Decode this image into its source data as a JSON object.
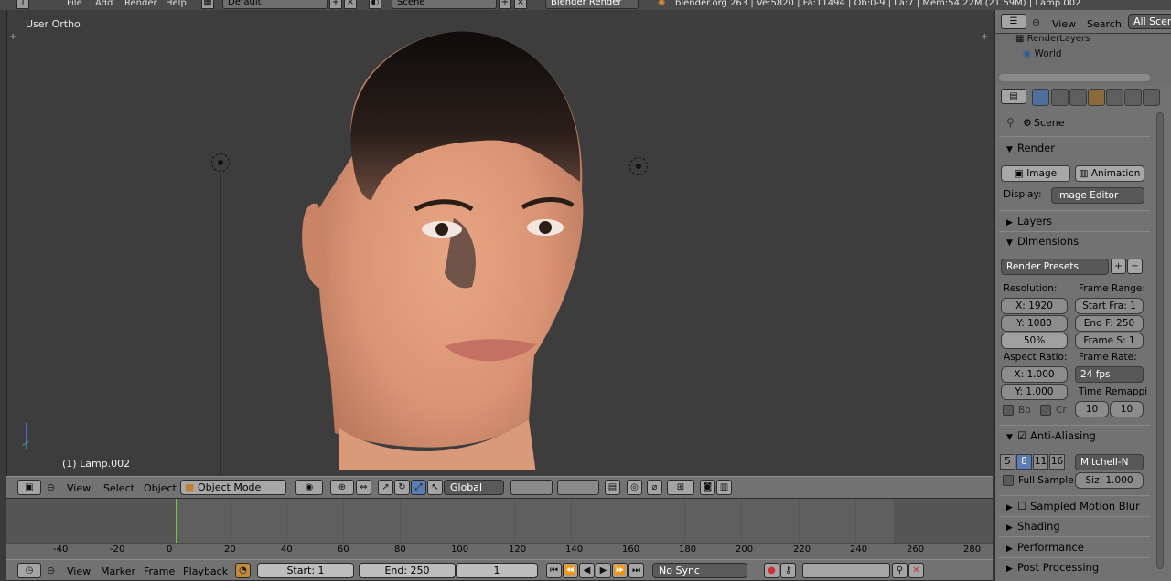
{
  "topbar": {
    "menus": [
      "File",
      "Add",
      "Render",
      "Help"
    ],
    "layout": "Default",
    "scene": "Scene",
    "engine": "Blender Render",
    "info": "blender.org 263 | Ve:5820 | Fa:11494 | Ob:0-9 | La:7 | Mem:54.22M (21.59M) | Lamp.002"
  },
  "viewport": {
    "title": "User Ortho",
    "object_label": "(1) Lamp.002"
  },
  "view3d_header": {
    "menus": [
      "View",
      "Select",
      "Object"
    ],
    "mode": "Object Mode",
    "orientation": "Global"
  },
  "timeline": {
    "frame_numbers": [
      "-40",
      "-20",
      "0",
      "20",
      "40",
      "60",
      "80",
      "100",
      "120",
      "140",
      "160",
      "180",
      "200",
      "220",
      "240",
      "260",
      "280"
    ],
    "menus": [
      "View",
      "Marker",
      "Frame",
      "Playback"
    ],
    "start": "Start: 1",
    "end": "End: 250",
    "current": "1",
    "sync": "No Sync"
  },
  "outliner": {
    "menus": [
      "View",
      "Search"
    ],
    "filter": "All Scen",
    "items": [
      "RenderLayers",
      "World"
    ]
  },
  "properties": {
    "context": "Scene",
    "render": {
      "title": "Render",
      "image_btn": "Image",
      "animation_btn": "Animation",
      "display_label": "Display:",
      "display_value": "Image Editor"
    },
    "layers_title": "Layers",
    "dimensions": {
      "title": "Dimensions",
      "presets": "Render Presets",
      "resolution_label": "Resolution:",
      "res_x": "X: 1920",
      "res_y": "Y: 1080",
      "res_pct": "50%",
      "frame_range_label": "Frame Range:",
      "start_frame": "Start Fra: 1",
      "end_frame": "End F: 250",
      "frame_step": "Frame S: 1",
      "aspect_label": "Aspect Ratio:",
      "aspect_x": "X: 1.000",
      "aspect_y": "Y: 1.000",
      "frame_rate_label": "Frame Rate:",
      "frame_rate": "24 fps",
      "time_remap_label": "Time Remappi",
      "remap_old": "10",
      "remap_new": "10",
      "border_label": "Bo",
      "crop_label": "Cr"
    },
    "anti_aliasing": {
      "title": "Anti-Aliasing",
      "samples": [
        "5",
        "8",
        "11",
        "16"
      ],
      "filter": "Mitchell-N",
      "full_sample": "Full Sample",
      "size": "Siz: 1.000"
    },
    "sampled_motion_blur": "Sampled Motion Blur",
    "shading": "Shading",
    "performance": "Performance",
    "post_processing": "Post Processing"
  },
  "colors": {
    "panel_bg": "#727272",
    "viewport_bg": "#3d3d3d",
    "accent_blue": "#5a7db4",
    "current_frame": "#5fcf3a"
  }
}
